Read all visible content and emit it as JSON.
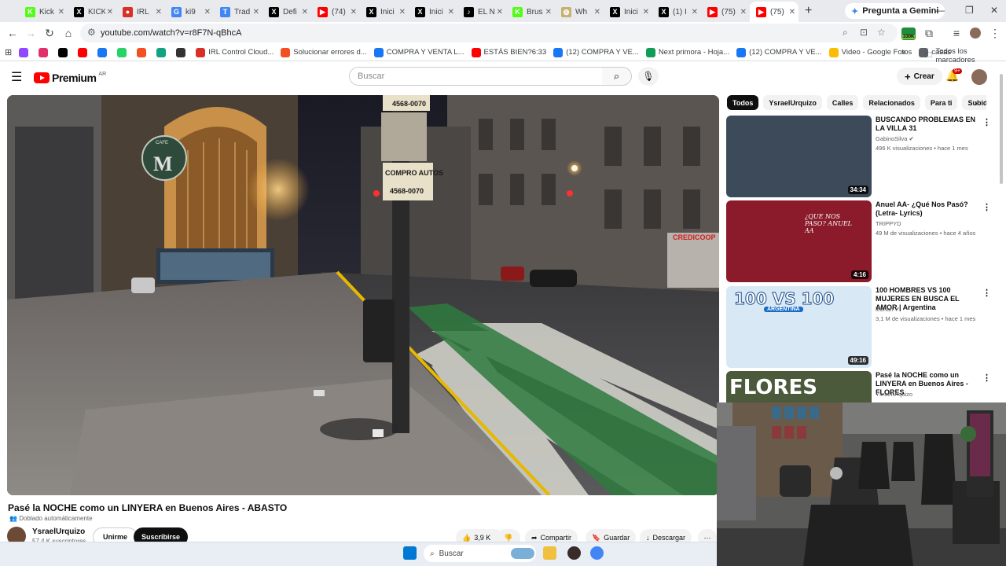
{
  "browser": {
    "tabs": [
      {
        "title": "Kick",
        "icon": "kick-icon",
        "color": "#53fc18"
      },
      {
        "title": "KICK",
        "icon": "x-icon",
        "color": "#000000"
      },
      {
        "title": "IRL",
        "icon": "irl-icon",
        "color": "#d93025"
      },
      {
        "title": "ki9",
        "icon": "google-icon",
        "color": "#4285f4"
      },
      {
        "title": "Trad",
        "icon": "translate-icon",
        "color": "#4285f4"
      },
      {
        "title": "Defi",
        "icon": "x-icon",
        "color": "#000000"
      },
      {
        "title": "(74)",
        "icon": "youtube-icon",
        "color": "#ff0000"
      },
      {
        "title": "Inici",
        "icon": "x-icon",
        "color": "#000000"
      },
      {
        "title": "Inici",
        "icon": "x-icon",
        "color": "#000000"
      },
      {
        "title": "EL N",
        "icon": "tiktok-icon",
        "color": "#000000"
      },
      {
        "title": "Brus",
        "icon": "kick-icon",
        "color": "#53fc18"
      },
      {
        "title": "Wh",
        "icon": "globe-icon",
        "color": "#c8b070"
      },
      {
        "title": "Inici",
        "icon": "x-icon",
        "color": "#000000"
      },
      {
        "title": "(1) I",
        "icon": "x-icon",
        "color": "#000000"
      },
      {
        "title": "(75)",
        "icon": "youtube-icon",
        "color": "#ff0000"
      },
      {
        "title": "(75)",
        "icon": "youtube-icon",
        "color": "#ff0000",
        "active": true
      }
    ],
    "gemini_label": "Pregunta a Gemini",
    "url": "youtube.com/watch?v=r8F7N-qBhcA",
    "extension_badge": "330K",
    "bookmarks": [
      {
        "label": "",
        "icon": "twitch-icon",
        "color": "#9146ff"
      },
      {
        "label": "",
        "icon": "instagram-icon",
        "color": "#e1306c"
      },
      {
        "label": "",
        "icon": "x-icon",
        "color": "#000000"
      },
      {
        "label": "",
        "icon": "youtube-icon",
        "color": "#ff0000"
      },
      {
        "label": "",
        "icon": "facebook-icon",
        "color": "#1877f2"
      },
      {
        "label": "",
        "icon": "whatsapp-icon",
        "color": "#25d366"
      },
      {
        "label": "",
        "icon": "microsoft-icon",
        "color": "#f25022"
      },
      {
        "label": "",
        "icon": "bot-icon",
        "color": "#10a37f"
      },
      {
        "label": "",
        "icon": "globe-icon",
        "color": "#333333"
      },
      {
        "label": "IRL Control Cloud...",
        "icon": "irl-icon",
        "color": "#d93025"
      },
      {
        "label": "Solucionar errores d...",
        "icon": "microsoft-icon",
        "color": "#f25022"
      },
      {
        "label": "COMPRA Y VENTA L...",
        "icon": "facebook-icon",
        "color": "#1877f2"
      },
      {
        "label": "ESTÁS BIEN?6:33",
        "icon": "youtube-icon",
        "color": "#ff0000"
      },
      {
        "label": "(12) COMPRA Y VE...",
        "icon": "facebook-icon",
        "color": "#1877f2"
      },
      {
        "label": "Next primora - Hoja...",
        "icon": "sheets-icon",
        "color": "#0f9d58"
      },
      {
        "label": "(12) COMPRA Y VE...",
        "icon": "facebook-icon",
        "color": "#1877f2"
      },
      {
        "label": "Video - Google Fotos",
        "icon": "photos-icon",
        "color": "#fbbc04"
      },
      {
        "label": "casas",
        "icon": "folder-icon",
        "color": "#5f6368"
      }
    ],
    "all_bookmarks": "Todos los marcadores"
  },
  "youtube": {
    "logo_word": "Premium",
    "logo_country": "AR",
    "search_placeholder": "Buscar",
    "create_label": "Crear",
    "notif_count": "9+",
    "video": {
      "title": "Pasé la NOCHE como un LINYERA en Buenos Aires - ABASTO",
      "dubbed": "Doblado automáticamente",
      "channel": "YsraelUrquizo",
      "subscribers": "57,4 K suscriptores",
      "join": "Unirme",
      "subscribe": "Suscribirse",
      "likes": "3,9 K",
      "share": "Compartir",
      "save": "Guardar",
      "download": "Descargar"
    },
    "chips": [
      "Todos",
      "YsraelUrquizo",
      "Calles",
      "Relacionados",
      "Para ti",
      "Subidas"
    ],
    "recommendations": [
      {
        "title": "BUSCANDO PROBLEMAS EN LA VILLA 31",
        "channel": "GabinoSilva",
        "verified": true,
        "meta": "496 K visualizaciones • hace 1 mes",
        "duration": "34:34",
        "thumb_color": "#3d4a5a"
      },
      {
        "title": "Anuel AA- ¿Qué Nos Pasó? (Letra- Lyrics)",
        "channel": "TRIPPYD",
        "verified": false,
        "meta": "49 M de visualizaciones • hace 4 años",
        "duration": "4:16",
        "thumb_color": "#8b1a2a",
        "thumb_text": "¿QUE NOS PASO? ANUEL AA"
      },
      {
        "title": "100 HOMBRES VS 100 MUJERES EN BUSCA EL AMOR | Argentina",
        "channel": "lebriah",
        "verified": true,
        "meta": "3,1 M de visualizaciones • hace 1 mes",
        "duration": "49:16",
        "thumb_color": "#d8e8f4",
        "thumb_text": "100 VS 100",
        "thumb_sub": "ARGENTINA"
      },
      {
        "title": "Pasé la NOCHE como un LINYERA en Buenos Aires - FLORES",
        "channel": "YsraelUrquizo",
        "verified": false,
        "meta": "",
        "duration": "",
        "thumb_color": "#4a5a3a",
        "thumb_text": "FLORES"
      }
    ]
  },
  "video_scene": {
    "poster_top": "4568-0070",
    "poster_mid": "COMPRO AUTOS",
    "poster_bottom": "4568-0070",
    "cafe_sign": "CAFE",
    "store_sign": "CREDICOOP"
  },
  "taskbar": {
    "search_placeholder": "Buscar"
  }
}
